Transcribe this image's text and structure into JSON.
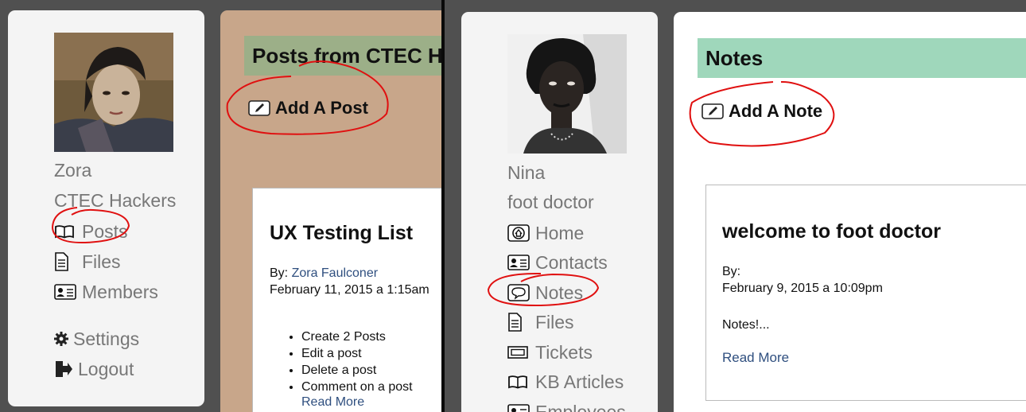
{
  "left": {
    "sidebar": {
      "user_name": "Zora",
      "group_name": "CTEC Hackers",
      "nav": [
        {
          "label": "Posts",
          "icon": "book-icon"
        },
        {
          "label": "Files",
          "icon": "file-icon"
        },
        {
          "label": "Members",
          "icon": "id-card-icon"
        }
      ],
      "settings_label": "Settings",
      "logout_label": "Logout"
    },
    "main": {
      "heading": "Posts from CTEC Hackers",
      "add_label": "Add A Post",
      "post": {
        "title": "UX Testing List",
        "by_prefix": "By: ",
        "author": "Zora Faulconer",
        "date": "February 11, 2015 a 1:15am",
        "items": [
          "Create 2 Posts",
          "Edit a post",
          "Delete a post",
          "Comment on a post"
        ],
        "read_more": "Read More"
      }
    }
  },
  "right": {
    "sidebar": {
      "user_name": "Nina",
      "group_name": "foot doctor",
      "nav": [
        {
          "label": "Home",
          "icon": "home-icon"
        },
        {
          "label": "Contacts",
          "icon": "id-card-icon"
        },
        {
          "label": "Notes",
          "icon": "speech-bubble-icon"
        },
        {
          "label": "Files",
          "icon": "file-icon"
        },
        {
          "label": "Tickets",
          "icon": "ticket-icon"
        },
        {
          "label": "KB Articles",
          "icon": "book-icon"
        },
        {
          "label": "Employees",
          "icon": "id-card-icon"
        }
      ]
    },
    "main": {
      "heading": "Notes",
      "add_label": "Add A Note",
      "note": {
        "title": "welcome to foot doctor",
        "by_label": "By:",
        "date": "February 9, 2015 a 10:09pm",
        "body": "Notes!...",
        "read_more": "Read More"
      }
    }
  },
  "colors": {
    "left_main_bg": "#c8a68a",
    "left_heading_bg": "#9caf88",
    "right_heading_bg": "#9fd7bb",
    "annotation": "#e01010",
    "link": "#2f4f7f"
  }
}
